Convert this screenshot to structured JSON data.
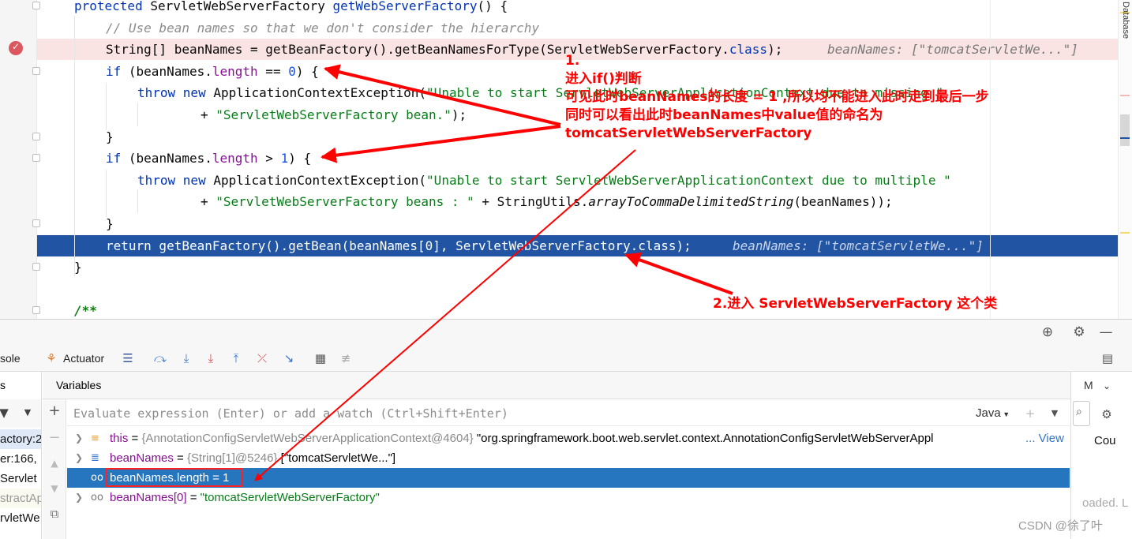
{
  "editor": {
    "lines": [
      {
        "kind": "plain",
        "parts": [
          [
            "kw",
            "protected "
          ],
          [
            "",
            "ServletWebServerFactory "
          ],
          [
            "kw",
            "getWebServerFactory"
          ],
          [
            "",
            "() {"
          ]
        ]
      },
      {
        "kind": "plain",
        "parts": [
          [
            "cmt",
            "// Use bean names so that we don't consider the hierarchy"
          ]
        ]
      },
      {
        "kind": "bp",
        "parts": [
          [
            "",
            "String[] beanNames = getBeanFactory().getBeanNamesForType(ServletWebServerFactory."
          ],
          [
            "kw",
            "class"
          ],
          [
            "",
            ");"
          ]
        ],
        "hint": "beanNames: [\"tomcatServletWe...\"]"
      },
      {
        "kind": "plain",
        "parts": [
          [
            "kw",
            "if "
          ],
          [
            "",
            "(beanNames."
          ],
          [
            "fld",
            "length"
          ],
          [
            "",
            " == "
          ],
          [
            "num",
            "0"
          ],
          [
            "",
            ") {"
          ]
        ]
      },
      {
        "kind": "plain",
        "parts": [
          [
            "kw",
            "throw new "
          ],
          [
            "",
            "ApplicationContextException("
          ],
          [
            "str",
            "\"Unable to start ServletWebServerApplicationContext due to missing \""
          ]
        ]
      },
      {
        "kind": "plain",
        "parts": [
          [
            "",
            "+ "
          ],
          [
            "str",
            "\"ServletWebServerFactory bean.\""
          ],
          [
            "",
            ");"
          ]
        ]
      },
      {
        "kind": "plain",
        "parts": [
          [
            "",
            "}"
          ]
        ]
      },
      {
        "kind": "plain",
        "parts": [
          [
            "kw",
            "if "
          ],
          [
            "",
            "(beanNames."
          ],
          [
            "fld",
            "length"
          ],
          [
            "",
            " > "
          ],
          [
            "num",
            "1"
          ],
          [
            "",
            ") {"
          ]
        ]
      },
      {
        "kind": "plain",
        "parts": [
          [
            "kw",
            "throw new "
          ],
          [
            "",
            "ApplicationContextException("
          ],
          [
            "str",
            "\"Unable to start ServletWebServerApplicationContext due to multiple \""
          ]
        ]
      },
      {
        "kind": "plain",
        "parts": [
          [
            "",
            "+ "
          ],
          [
            "str",
            "\"ServletWebServerFactory beans : \""
          ],
          [
            "",
            " + StringUtils."
          ],
          [
            "ital",
            "arrayToCommaDelimitedString"
          ],
          [
            "",
            "(beanNames));"
          ]
        ]
      },
      {
        "kind": "plain",
        "parts": [
          [
            "",
            "}"
          ]
        ]
      },
      {
        "kind": "exec",
        "parts": [
          [
            "",
            "return getBeanFactory().getBean(beanNames[0], ServletWebServerFactory.class);"
          ]
        ],
        "hint": "beanNames: [\"tomcatServletWe...\"]"
      },
      {
        "kind": "plain",
        "parts": [
          [
            "",
            "}"
          ]
        ]
      },
      {
        "kind": "plain",
        "parts": [
          [
            "",
            ""
          ]
        ]
      },
      {
        "kind": "plain",
        "parts": [
          [
            "doc-cmt",
            "/**"
          ]
        ]
      }
    ]
  },
  "side_tool": {
    "database_label": "Database"
  },
  "annotations": {
    "note1_lines": [
      "1.",
      "进入if()判断",
      "可见此时beanNames的长度 = 1 ,所以均不能进入此时走到最后一步",
      "同时可以看出此时beanNames中value值的命名为",
      "tomcatServletWebServerFactory"
    ],
    "note2": "2.进入 ServletWebServerFactory 这个类"
  },
  "debug": {
    "tabs": {
      "console": "sole",
      "actuator": "Actuator"
    },
    "frames_title": "s",
    "frames": [
      "actory:2",
      "er:166,",
      "Servlet",
      "stractAp",
      "rvletWe"
    ],
    "variables_title": "Variables",
    "eval_placeholder": "Evaluate expression (Enter) or add a watch (Ctrl+Shift+Enter)",
    "lang": "Java",
    "watch_label": "Cou",
    "watch_header": "M",
    "loaded_text": "oaded. L",
    "vars": [
      {
        "name": "this",
        "type": "{AnnotationConfigServletWebServerApplicationContext@4604}",
        "value": "\"org.springframework.boot.web.servlet.context.AnnotationConfigServletWebServerAppl",
        "link": "... View"
      },
      {
        "name": "beanNames",
        "type": "{String[1]@5246}",
        "value": "[\"tomcatServletWe...\"]"
      },
      {
        "name": "beanNames.length",
        "eq": " = ",
        "value": "1"
      },
      {
        "name": "beanNames[0]",
        "eq": " = ",
        "value": "\"tomcatServletWebServerFactory\""
      }
    ]
  },
  "watermark": "CSDN @徐了叶"
}
